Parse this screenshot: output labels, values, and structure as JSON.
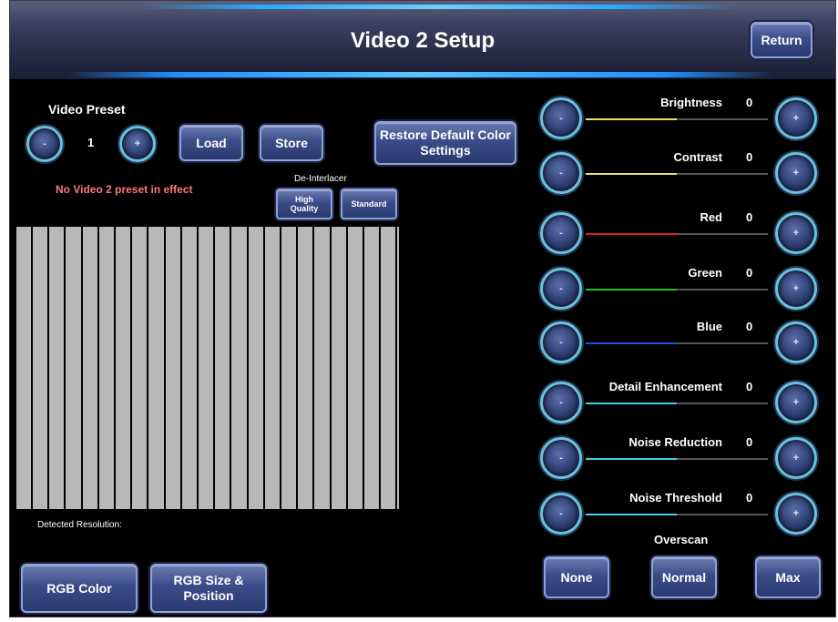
{
  "header": {
    "title": "Video 2 Setup",
    "return_label": "Return"
  },
  "preset": {
    "label": "Video Preset",
    "minus": "-",
    "plus": "+",
    "value": "1",
    "load_label": "Load",
    "store_label": "Store",
    "status": "No Video 2 preset in effect"
  },
  "restore_label": "Restore Default Color Settings",
  "deinterlacer": {
    "label": "De-Interlacer",
    "high_quality": "High Quality",
    "standard": "Standard"
  },
  "detected_resolution_label": "Detected Resolution:",
  "bottom": {
    "rgb_color": "RGB Color",
    "rgb_size": "RGB Size & Position"
  },
  "adjustments": [
    {
      "name": "Brightness",
      "value": "0",
      "color": "#e8e070"
    },
    {
      "name": "Contrast",
      "value": "0",
      "color": "#e8e070"
    },
    {
      "name": "Red",
      "value": "0",
      "color": "#e02020"
    },
    {
      "name": "Green",
      "value": "0",
      "color": "#20c020"
    },
    {
      "name": "Blue",
      "value": "0",
      "color": "#2050e0"
    },
    {
      "name": "Detail Enhancement",
      "value": "0",
      "color": "#40d0e0"
    },
    {
      "name": "Noise Reduction",
      "value": "0",
      "color": "#40d0e0"
    },
    {
      "name": "Noise Threshold",
      "value": "0",
      "color": "#40d0e0"
    }
  ],
  "overscan": {
    "label": "Overscan",
    "none": "None",
    "normal": "Normal",
    "max": "Max"
  }
}
